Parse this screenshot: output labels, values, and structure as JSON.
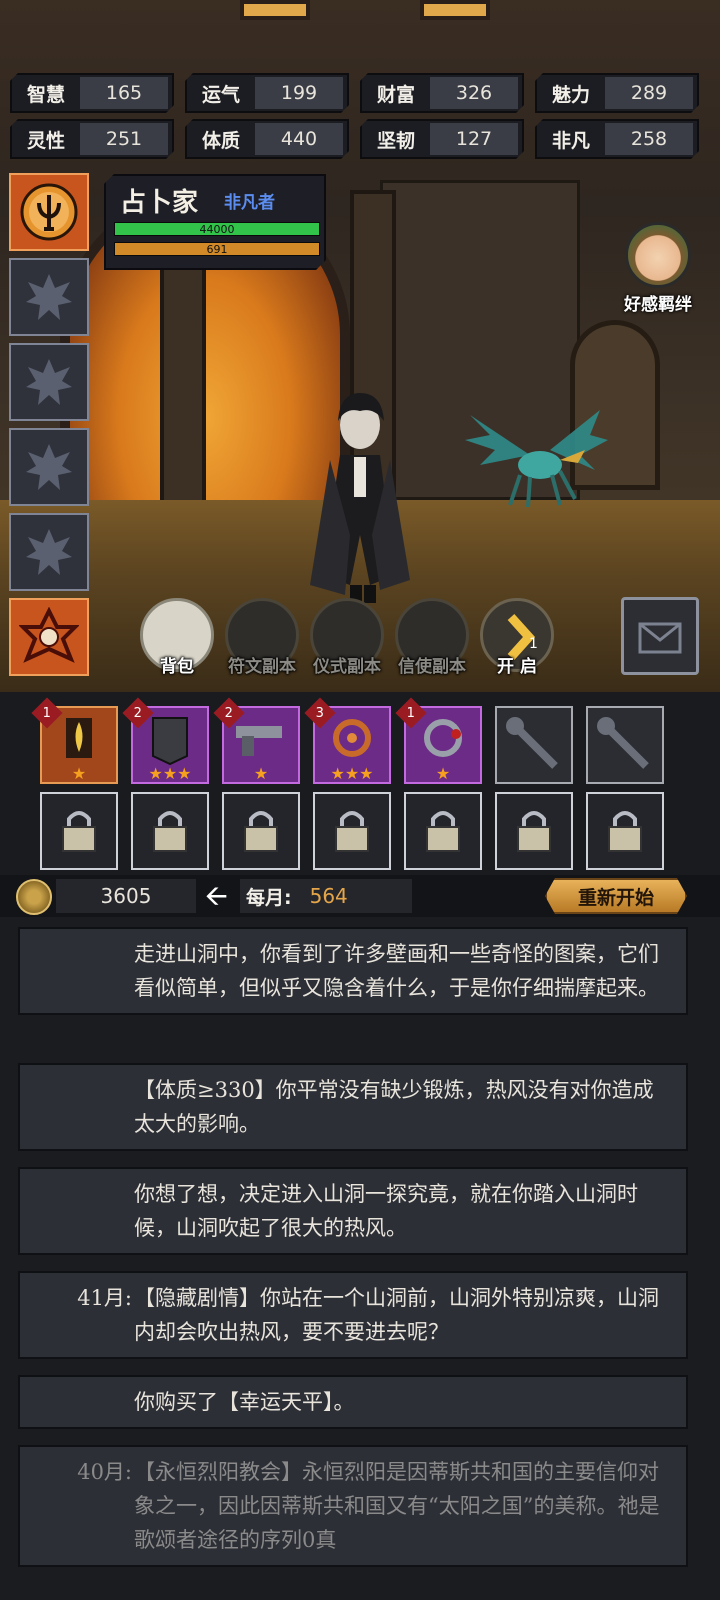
{
  "stats": [
    {
      "label": "智慧",
      "value": "165"
    },
    {
      "label": "运气",
      "value": "199"
    },
    {
      "label": "财富",
      "value": "326"
    },
    {
      "label": "魅力",
      "value": "289"
    },
    {
      "label": "灵性",
      "value": "251"
    },
    {
      "label": "体质",
      "value": "440"
    },
    {
      "label": "坚韧",
      "value": "127"
    },
    {
      "label": "非凡",
      "value": "258"
    }
  ],
  "character": {
    "class_name": "占卜家",
    "rank": "非凡者",
    "hp": "44000",
    "mp": "691"
  },
  "affinity_label": "好感羁绊",
  "actions": [
    {
      "label": "背包"
    },
    {
      "label": "符文副本"
    },
    {
      "label": "仪式副本"
    },
    {
      "label": "信使副本"
    },
    {
      "label": "开 启",
      "badge": "1"
    }
  ],
  "equipment": [
    {
      "level": "1",
      "stars": "★",
      "rarity": "gold"
    },
    {
      "level": "2",
      "stars": "★★★",
      "rarity": "purple"
    },
    {
      "level": "2",
      "stars": "★",
      "rarity": "purple"
    },
    {
      "level": "3",
      "stars": "★★★",
      "rarity": "purple"
    },
    {
      "level": "1",
      "stars": "★",
      "rarity": "purple"
    }
  ],
  "resources": {
    "coins": "3605",
    "monthly_label": "每月:",
    "monthly_value": "564",
    "restart_label": "重新开始"
  },
  "log": [
    {
      "month": "",
      "text": "走进山洞中，你看到了许多壁画和一些奇怪的图案，它们看似简单，但似乎又隐含着什么，于是你仔细揣摩起来。"
    },
    {
      "month": "",
      "text": "【体质≥330】你平常没有缺少锻炼，热风没有对你造成太大的影响。"
    },
    {
      "month": "",
      "text": "你想了想，决定进入山洞一探究竟，就在你踏入山洞时候，山洞吹起了很大的热风。"
    },
    {
      "month": "41月:",
      "text": "【隐藏剧情】你站在一个山洞前，山洞外特别凉爽，山洞内却会吹出热风，要不要进去呢？"
    },
    {
      "month": "",
      "text": "你购买了【幸运天平】。"
    },
    {
      "month": "40月:",
      "text": "【永恒烈阳教会】永恒烈阳是因蒂斯共和国的主要信仰对象之一，因此因蒂斯共和国又有“太阳之国”的美称。祂是歌颂者途径的序列0真"
    }
  ],
  "colors": {
    "hp": "#32c34a",
    "mp": "#d28a28",
    "rank": "#5b8df0",
    "monthly_value": "#e5a64a",
    "restart": "#e8b25a",
    "rarity_gold": "#a2461c",
    "rarity_purple": "#6c2b86"
  },
  "icons": {
    "active_skill": "trident-emblem-icon",
    "empty_skill": "eight-point-star-icon",
    "bottom_skill": "red-hexagram-icon",
    "coin": "coin-icon",
    "arrow": "arrow-left-icon",
    "mail": "envelope-icon",
    "lock": "padlock-icon",
    "locked_equipment": "wrench-icon"
  }
}
